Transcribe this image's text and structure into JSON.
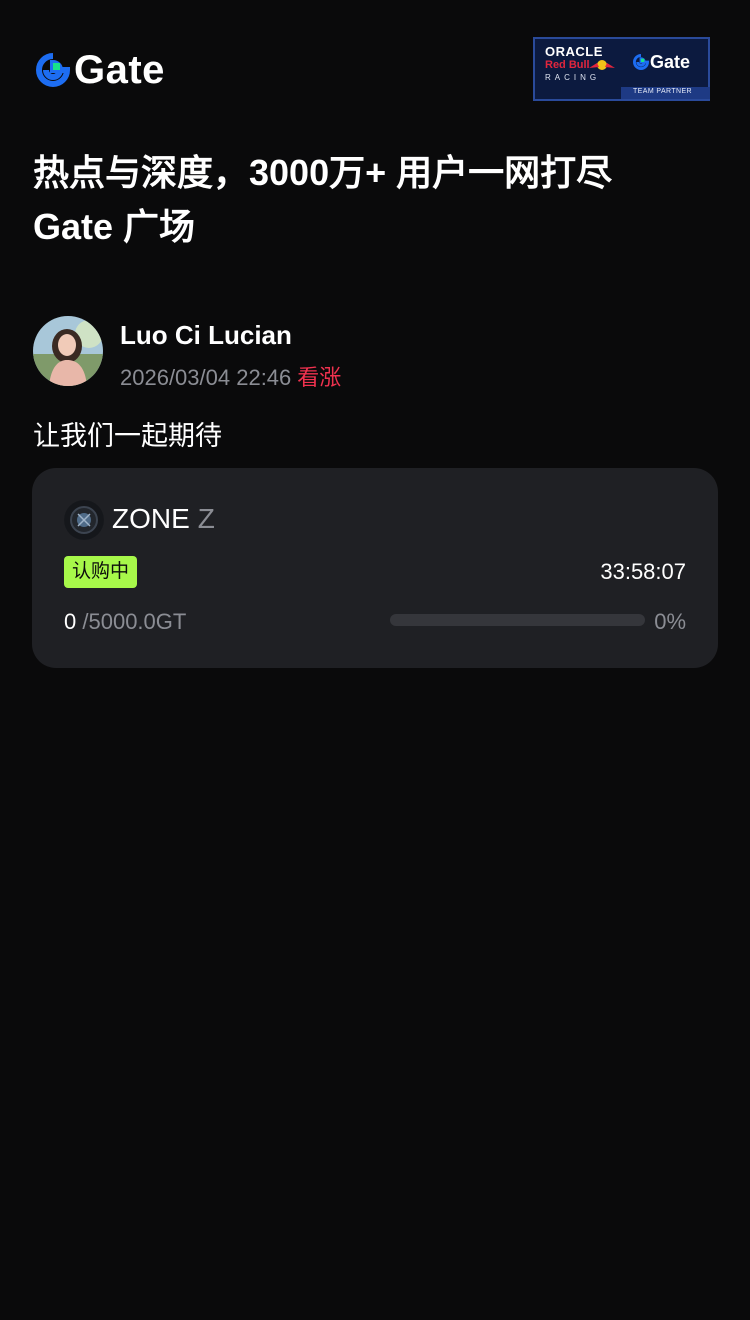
{
  "header": {
    "logo_text": "Gate",
    "partner": {
      "oracle": "ORACLE",
      "red_bull": "Red Bull",
      "racing": "RACING",
      "gate": "Gate",
      "team_partner": "TEAM PARTNER"
    }
  },
  "headline": {
    "line1": "热点与深度，3000万+ 用户一网打尽",
    "line2": "Gate 广场"
  },
  "post": {
    "author_name": "Luo Ci Lucian",
    "datetime": "2026/03/04 22:46",
    "sentiment": "看涨",
    "text": "让我们一起期待"
  },
  "card": {
    "token_name": "ZONE",
    "token_ticker": "Z",
    "status": "认购中",
    "countdown": "33:58:07",
    "subscribed": "0",
    "total": "/5000.0GT",
    "progress_fraction": 0,
    "percent": "0%"
  },
  "colors": {
    "background": "#0a0a0b",
    "card": "#1f2024",
    "accent_green": "#a7f84a",
    "bullish_red": "#f0324f",
    "gate_blue": "#1d6df2",
    "muted": "#8b8d94"
  }
}
